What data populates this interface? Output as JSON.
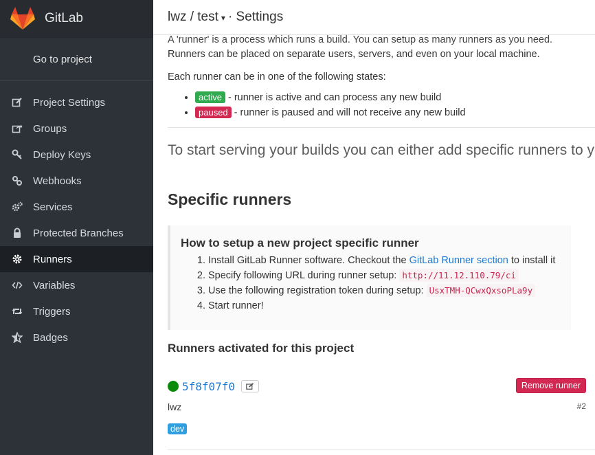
{
  "app": {
    "name": "GitLab"
  },
  "colors": {
    "sidebar_bg": "#2d3238",
    "active_label": "#2faa4e",
    "paused_label": "#d22852",
    "link": "#1f78d1"
  },
  "sidebar": {
    "goto": "Go to project",
    "items": [
      {
        "label": "Project Settings",
        "icon": "edit-icon"
      },
      {
        "label": "Groups",
        "icon": "share-icon"
      },
      {
        "label": "Deploy Keys",
        "icon": "key-icon"
      },
      {
        "label": "Webhooks",
        "icon": "link-icon"
      },
      {
        "label": "Services",
        "icon": "cogs-icon"
      },
      {
        "label": "Protected Branches",
        "icon": "lock-icon"
      },
      {
        "label": "Runners",
        "icon": "cog-icon",
        "active": true
      },
      {
        "label": "Variables",
        "icon": "code-icon"
      },
      {
        "label": "Triggers",
        "icon": "retweet-icon"
      },
      {
        "label": "Badges",
        "icon": "star-half-icon"
      }
    ]
  },
  "header": {
    "project": "lwz / test",
    "section": "· Settings"
  },
  "content": {
    "intro_line1": "A 'runner' is a process which runs a build. You can setup as many runners as you need.",
    "intro_line2": "Runners can be placed on separate users, servers, and even on your local machine.",
    "states_intro": "Each runner can be in one of the following states:",
    "states": [
      {
        "label": "active",
        "desc": " - runner is active and can process any new build"
      },
      {
        "label": "paused",
        "desc": " - runner is paused and will not receive any new build"
      }
    ],
    "lead": "To start serving your builds you can either add specific runners to you",
    "specific_title": "Specific runners",
    "setup": {
      "title": "How to setup a new project specific runner",
      "step1_pre": "Install GitLab Runner software. Checkout the ",
      "step1_link": "GitLab Runner section",
      "step1_post": " to install it",
      "step2_pre": "Specify following URL during runner setup: ",
      "step2_url": "http://11.12.110.79/ci",
      "step3_pre": "Use the following registration token during setup: ",
      "step3_token": "UsxTMH-QCwxQxsoPLa9y",
      "step4": "Start runner!"
    },
    "activated_title": "Runners activated for this project",
    "runner": {
      "token": "5f8f07f0",
      "remove": "Remove runner",
      "description": "lwz",
      "number": "#2",
      "tag": "dev"
    }
  }
}
